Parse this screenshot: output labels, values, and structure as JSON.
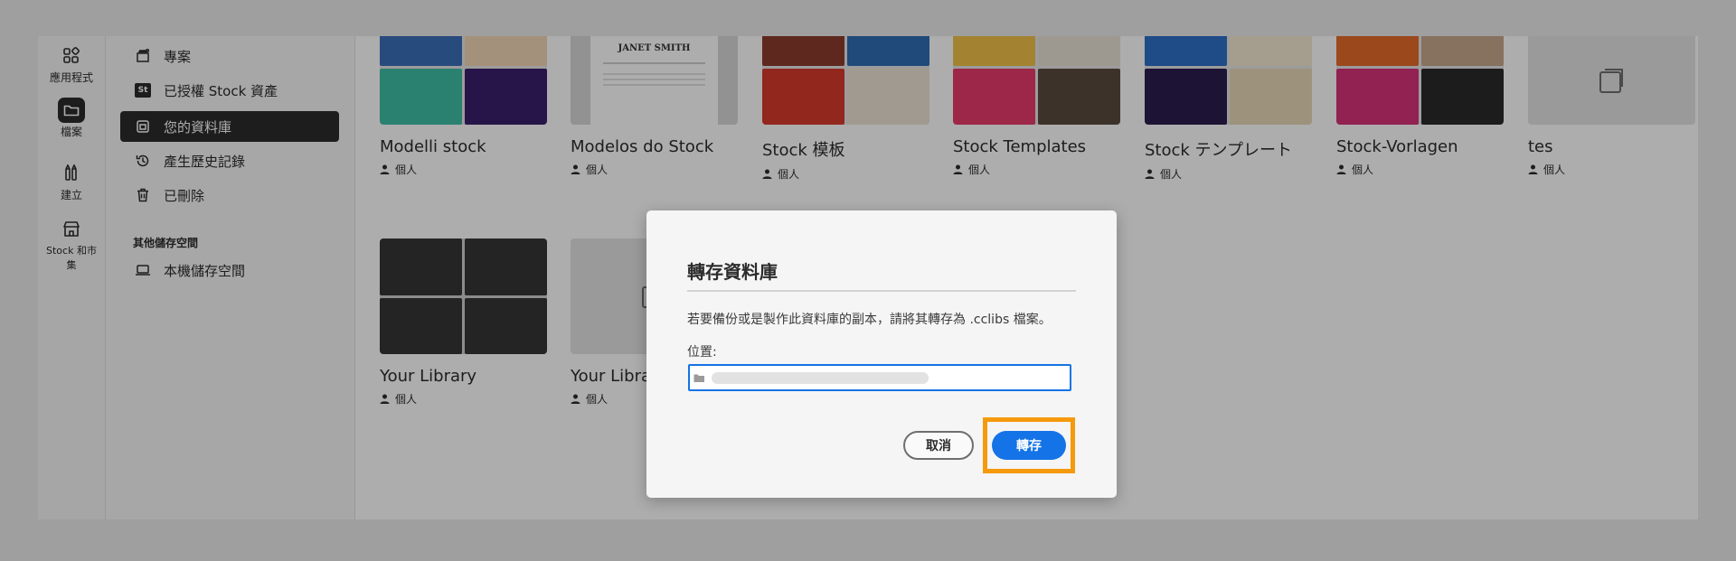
{
  "rail": {
    "items": [
      {
        "label": "應用程式",
        "icon": "apps-icon"
      },
      {
        "label": "檔案",
        "icon": "folder-icon",
        "active": true
      },
      {
        "label": "建立",
        "icon": "create-icon"
      },
      {
        "label": "Stock 和市集",
        "icon": "store-icon"
      }
    ]
  },
  "nav": {
    "items": [
      {
        "label": "專案",
        "icon": "projects-icon"
      },
      {
        "label": "已授權 Stock 資產",
        "icon": "stock-icon",
        "badge": "St"
      },
      {
        "label": "您的資料庫",
        "icon": "library-icon",
        "active": true
      },
      {
        "label": "產生歷史記錄",
        "icon": "history-icon"
      },
      {
        "label": "已刪除",
        "icon": "trash-icon"
      }
    ],
    "section_title": "其他儲存空間",
    "storage_items": [
      {
        "label": "本機儲存空間",
        "icon": "laptop-icon"
      }
    ]
  },
  "libraries": [
    {
      "title": "Modelli stock",
      "owner": "個人"
    },
    {
      "title": "Modelos do Stock",
      "owner": "個人",
      "thumb_text": "JANET SMITH"
    },
    {
      "title": "Stock 模板",
      "owner": "個人"
    },
    {
      "title": "Stock Templates",
      "owner": "個人"
    },
    {
      "title": "Stock テンプレート",
      "owner": "個人"
    },
    {
      "title": "Stock-Vorlagen",
      "owner": "個人"
    },
    {
      "title": "tes",
      "owner": "個人"
    },
    {
      "title": "Your Library",
      "owner": "個人"
    },
    {
      "title": "Your Library",
      "owner": "個人"
    }
  ],
  "dialog": {
    "title": "轉存資料庫",
    "description": "若要備份或是製作此資料庫的副本，請將其轉存為 .cclibs 檔案。",
    "location_label": "位置:",
    "location_value": "",
    "cancel_label": "取消",
    "export_label": "轉存"
  },
  "colors": {
    "accent": "#1473e6",
    "highlight": "#f59a0d",
    "active_nav": "#2c2c2c"
  }
}
